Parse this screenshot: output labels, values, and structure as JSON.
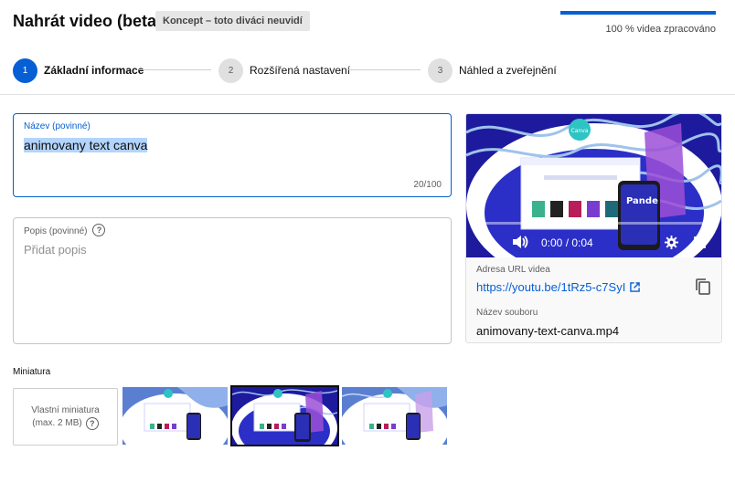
{
  "header": {
    "title": "Nahrát video (beta)",
    "draft_badge": "Koncept – toto diváci neuvidí",
    "progress_text": "100 % videa zpracováno",
    "progress_percent": 100,
    "accent_color": "#065fd4"
  },
  "steps": [
    {
      "number": "1",
      "label": "Základní informace",
      "active": true
    },
    {
      "number": "2",
      "label": "Rozšířená nastavení",
      "active": false
    },
    {
      "number": "3",
      "label": "Náhled a zveřejnění",
      "active": false
    }
  ],
  "title_field": {
    "label": "Název (povinné)",
    "value": "animovany text canva",
    "counter": "20/100"
  },
  "description_field": {
    "label": "Popis (povinné)",
    "placeholder": "Přidat popis",
    "help_icon": "help-circle-icon"
  },
  "preview": {
    "time": "0:00 / 0:04",
    "url_label": "Adresa URL videa",
    "url": "https://youtu.be/1tRz5-c7SyI",
    "filename_label": "Název souboru",
    "filename": "animovany-text-canva.mp4",
    "video_logo_text": "Canva",
    "video_headline": "Pande",
    "icons": [
      "play-icon",
      "volume-icon",
      "settings-gear-icon",
      "fullscreen-icon",
      "external-link-icon",
      "copy-icon"
    ]
  },
  "thumbnails": {
    "label": "Miniatura",
    "upload_line1": "Vlastní miniatura",
    "upload_line2": "(max. 2 MB)",
    "options_count": 3,
    "selected_index": 1
  }
}
